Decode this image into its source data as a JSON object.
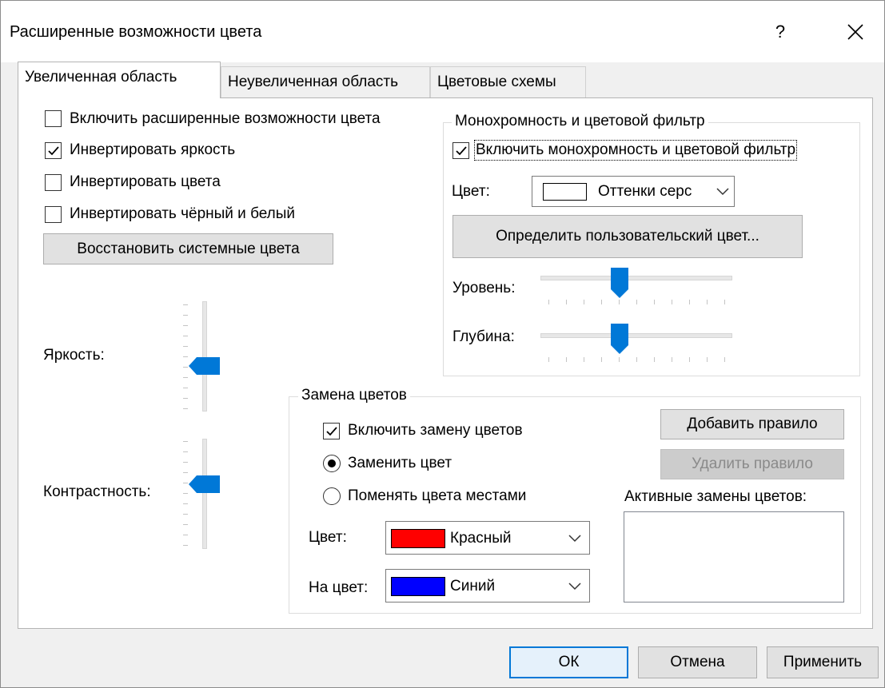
{
  "window": {
    "title": "Расширенные возможности цвета",
    "help_label": "?"
  },
  "tabs": [
    {
      "label": "Увеличенная область",
      "active": true
    },
    {
      "label": "Неувеличенная область",
      "active": false
    },
    {
      "label": "Цветовые схемы",
      "active": false
    }
  ],
  "options": {
    "enable_advanced": {
      "label": "Включить расширенные возможности цвета",
      "checked": false
    },
    "invert_brightness": {
      "label": "Инвертировать яркость",
      "checked": true
    },
    "invert_colors": {
      "label": "Инвертировать цвета",
      "checked": false
    },
    "invert_black_white": {
      "label": "Инвертировать чёрный и белый",
      "checked": false
    },
    "restore_button": "Восстановить системные цвета"
  },
  "sliders_vertical": {
    "brightness_label": "Яркость:",
    "contrast_label": "Контрастность:"
  },
  "mono": {
    "group_title": "Монохромность и цветовой фильтр",
    "enable": {
      "label": "Включить монохромность и цветовой фильтр",
      "checked": true
    },
    "color_label": "Цвет:",
    "color_value": "Оттенки серс",
    "color_swatch": "#ffffff",
    "custom_button": "Определить пользовательский цвет...",
    "level_label": "Уровень:",
    "depth_label": "Глубина:"
  },
  "replace": {
    "group_title": "Замена цветов",
    "enable": {
      "label": "Включить замену цветов",
      "checked": true
    },
    "radio_replace": {
      "label": "Заменить цвет",
      "selected": true
    },
    "radio_swap": {
      "label": "Поменять цвета местами",
      "selected": false
    },
    "color_label": "Цвет:",
    "color_value": "Красный",
    "color_swatch": "#ff0000",
    "to_color_label": "На цвет:",
    "to_color_value": "Синий",
    "to_color_swatch": "#0000ff",
    "add_rule": "Добавить правило",
    "delete_rule": "Удалить правило",
    "active_label": "Активные замены цветов:"
  },
  "footer": {
    "ok": "ОК",
    "cancel": "Отмена",
    "apply": "Применить"
  },
  "colors": {
    "accent": "#0078d7"
  }
}
